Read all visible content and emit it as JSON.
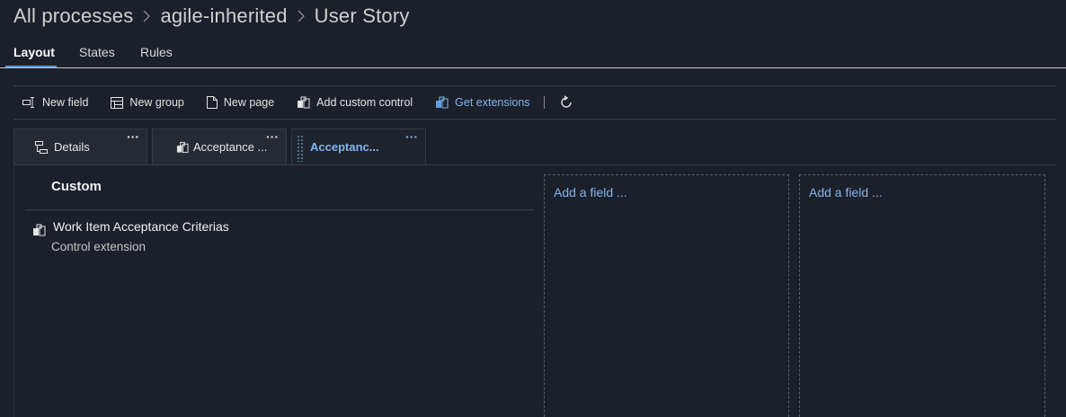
{
  "breadcrumb": {
    "items": [
      "All processes",
      "agile-inherited",
      "User Story"
    ]
  },
  "tabs": [
    {
      "label": "Layout",
      "active": true
    },
    {
      "label": "States",
      "active": false
    },
    {
      "label": "Rules",
      "active": false
    }
  ],
  "toolbar": {
    "new_field": "New field",
    "new_group": "New group",
    "new_page": "New page",
    "add_custom_control": "Add custom control",
    "get_extensions": "Get extensions",
    "refresh_icon": "refresh-icon"
  },
  "page_tabs": [
    {
      "label": "Details",
      "icon": "tree-icon",
      "active": false
    },
    {
      "label": "Acceptance ...",
      "icon": "extension-icon",
      "active": false
    },
    {
      "label": "Acceptanc...",
      "icon": "grip-icon",
      "active": true
    }
  ],
  "group": {
    "title": "Custom",
    "fields": [
      {
        "name": "Work Item Acceptance Criterias",
        "sub": "Control extension",
        "icon": "extension-icon"
      }
    ]
  },
  "sections": [
    {
      "add_label": "Add a field ..."
    },
    {
      "add_label": "Add a field ..."
    }
  ],
  "colors": {
    "background": "#1c202a",
    "accent": "#7fb6ef",
    "underline": "#4f9be6"
  }
}
